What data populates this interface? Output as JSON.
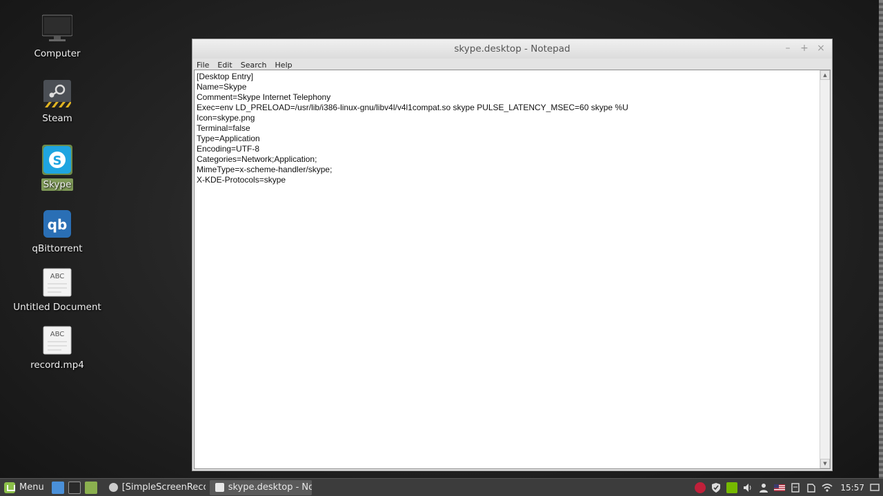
{
  "desktop": {
    "icons": [
      {
        "label": "Computer"
      },
      {
        "label": "Steam"
      },
      {
        "label": "Skype"
      },
      {
        "label": "qBittorrent"
      },
      {
        "label": "Untitled Document",
        "badge": "ABC"
      },
      {
        "label": "record.mp4",
        "badge": "ABC"
      }
    ],
    "selected": "Skype"
  },
  "window": {
    "title": "skype.desktop - Notepad",
    "menu": [
      "File",
      "Edit",
      "Search",
      "Help"
    ],
    "lines": [
      "[Desktop Entry]",
      "Name=Skype",
      "Comment=Skype Internet Telephony",
      "Exec=env LD_PRELOAD=/usr/lib/i386-linux-gnu/libv4l/v4l1compat.so skype PULSE_LATENCY_MSEC=60 skype %U",
      "Icon=skype.png",
      "Terminal=false",
      "Type=Application",
      "Encoding=UTF-8",
      "Categories=Network;Application;",
      "MimeType=x-scheme-handler/skype;",
      "X-KDE-Protocols=skype"
    ]
  },
  "taskbar": {
    "menu_label": "Menu",
    "tasks": [
      {
        "label": "[SimpleScreenReco..."
      },
      {
        "label": "skype.desktop - No..."
      }
    ],
    "clock": "15:57"
  },
  "colors": {
    "selection": "#7f9a58",
    "skype_blue": "#1fa5e0",
    "qbit_blue": "#2a6fb5",
    "mint_green": "#8cc04a"
  }
}
